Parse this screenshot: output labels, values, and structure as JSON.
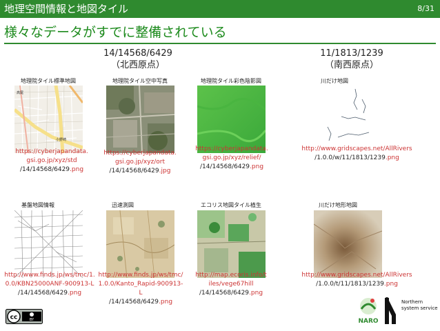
{
  "header": {
    "title": "地理空間情報と地図タイル",
    "page": "8/31"
  },
  "heading": "様々なデータがすでに整備されている",
  "groups": {
    "left": {
      "coords": "14/14568/6429",
      "origin": "（北西原点）"
    },
    "right": {
      "coords": "11/1813/1239",
      "origin": "（南西原点）"
    }
  },
  "tiles": [
    {
      "caption": "地理院タイル標準地図",
      "url1": "https://cyberjapandata.",
      "url2": "gsi.go.jp/xyz/std",
      "url3": "/14/14568/6429",
      "ext": ".png",
      "small_label_1": "高尾",
      "small_label_2": "小野崎"
    },
    {
      "caption": "地理院タイル空中写真",
      "url1": "https://cyberjapandata.",
      "url2": "gsi.go.jp/xyz/ort",
      "url3": "/14/14568/6429",
      "ext": ".jpg"
    },
    {
      "caption": "地理院タイル彩色陰影図",
      "url1": "https://cyberjapandata.",
      "url2": "gsi.go.jp/xyz/relief/",
      "url3": "/14/14568/6429",
      "ext": ".png"
    },
    {
      "caption": "川だけ地図",
      "url1": "http://www.gridscapes.net/AllRivers",
      "url2": "/1.0.0/w/11/1813/1239",
      "ext": ".png"
    },
    {
      "caption": "基盤地図情報",
      "url1": "http://www.finds.jp/ws/tmc/1.",
      "url2": "0.0/KBN25000ANF-900913-L",
      "url3": "/14/14568/6429",
      "ext": ".png"
    },
    {
      "caption": "迅速測図",
      "url1": "http://www.finds.jp/ws/tmc/",
      "url2": "1.0.0/Kanto_Rapid-900913-L",
      "url3": "/14/14568/6429",
      "ext": ".png"
    },
    {
      "caption": "エコリス地図タイル植生",
      "url1": "http://map.ecoris.info/t",
      "url2": "iles/vege67hill",
      "url3": "/14/14568/6429",
      "ext": ".png"
    },
    {
      "caption": "川だけ地形地図",
      "url1": "http://www.gridscapes.net/AllRivers",
      "url2": "/1.0.0/t/11/1813/1239",
      "ext": ".png"
    }
  ],
  "footer": {
    "cc_label": "cc",
    "cc_by": "BY",
    "naro_label": "NARO",
    "ns_line1": "Northern",
    "ns_line2": "system service"
  },
  "colors": {
    "bar": "#2f8a2f",
    "heading": "#1c8a1c",
    "ext": "#cc3333"
  }
}
